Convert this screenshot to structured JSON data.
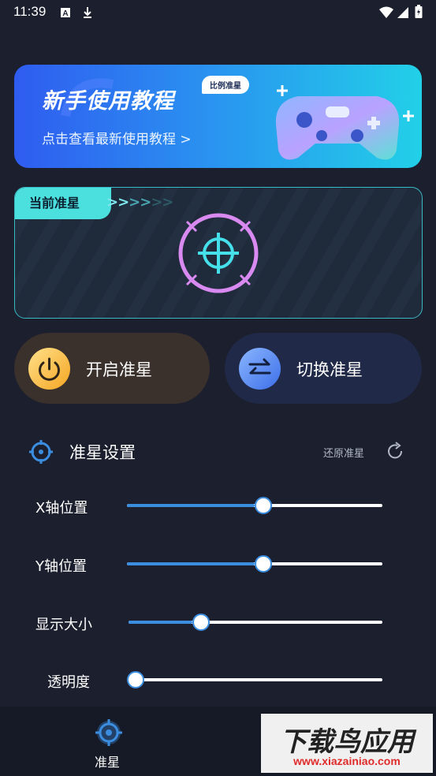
{
  "status_bar": {
    "time": "11:39"
  },
  "banner": {
    "title": "新手使用教程",
    "bubble": "比例准星",
    "subtitle": "点击查看最新使用教程 >"
  },
  "crosshair_card": {
    "tag": "当前准星",
    "arrows": ">>>>>>"
  },
  "buttons": {
    "open_label": "开启准星",
    "switch_label": "切换准星"
  },
  "settings": {
    "title": "准星设置",
    "restore_label": "还原准星",
    "sliders": [
      {
        "label": "X轴位置",
        "value": 0.5
      },
      {
        "label": "Y轴位置",
        "value": 0.5
      },
      {
        "label": "显示大小",
        "value": 0.25
      },
      {
        "label": "透明度",
        "value": 0.0
      }
    ]
  },
  "bottom_nav": {
    "label": "准星"
  },
  "watermark": {
    "title": "下载鸟应用",
    "url": "www.xiazainiao.com"
  },
  "colors": {
    "accent": "#3b8de0",
    "teal": "#4be0de",
    "crosshair": "#d98af0"
  }
}
